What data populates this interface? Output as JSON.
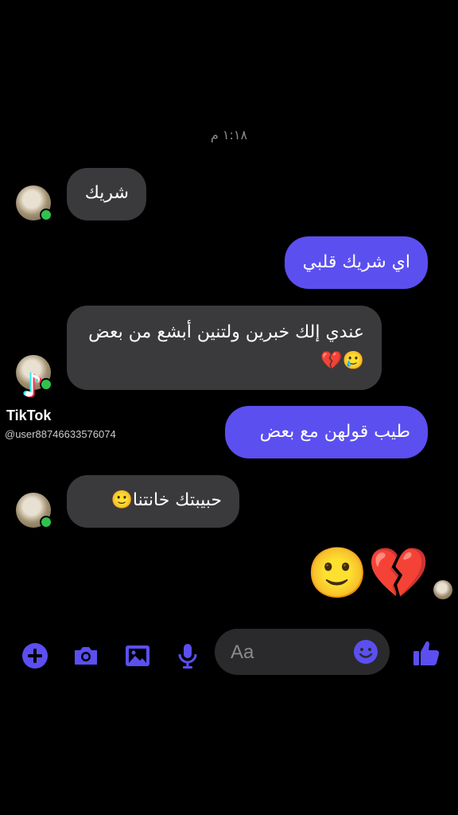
{
  "timestamp": "١:١٨ م",
  "messages": [
    {
      "side": "in",
      "text": "شريك"
    },
    {
      "side": "out",
      "text": "اي شريك قلبي"
    },
    {
      "side": "in",
      "text": "عندي إلك خبرين ولتنين أبشع من بعض🥲💔"
    },
    {
      "side": "out",
      "text": "طيب قولهن مع بعض"
    },
    {
      "side": "in",
      "text": "حبيبتك خانتنا🙂"
    }
  ],
  "last_sent_emoji": "💔🙂",
  "watermark": {
    "brand": "TikTok",
    "username": "@user88746633576074"
  },
  "composer": {
    "placeholder": "Aa"
  },
  "icons": [
    "plus-icon",
    "camera-icon",
    "image-icon",
    "microphone-icon",
    "emoji-icon",
    "thumbs-up-icon"
  ],
  "colors": {
    "accent": "#5b4ff0",
    "incoming_bubble": "#3a3a3c",
    "online": "#31c24d"
  }
}
